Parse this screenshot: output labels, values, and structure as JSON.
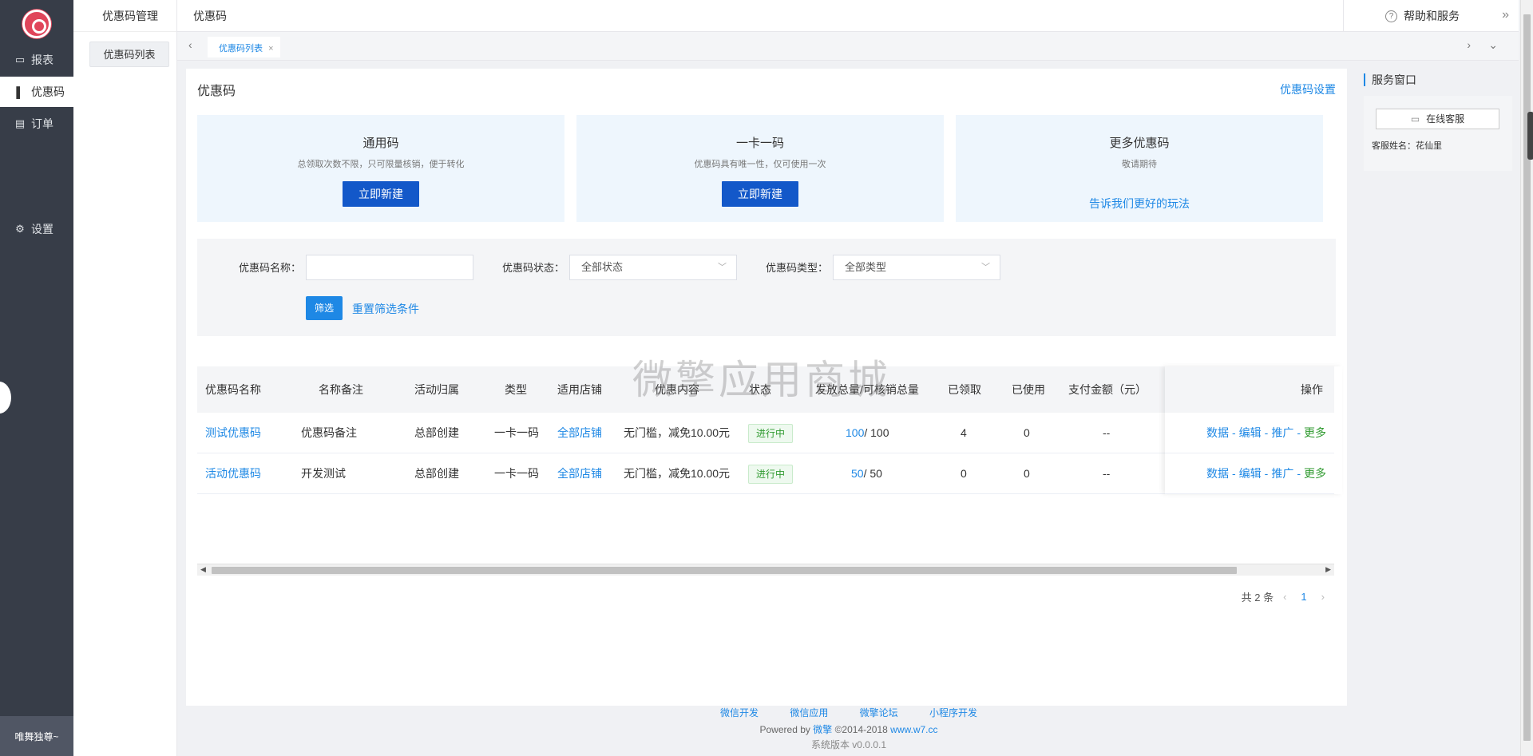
{
  "sidebar": {
    "items": [
      {
        "icon": "monitor-icon",
        "glyph": "▭",
        "label": "报表"
      },
      {
        "icon": "bar-chart-icon",
        "glyph": "▌",
        "label": "优惠码"
      },
      {
        "icon": "document-icon",
        "glyph": "▤",
        "label": "订单"
      },
      {
        "icon": "gear-icon",
        "glyph": "⚙",
        "label": "设置"
      }
    ],
    "user": "唯舞独尊~"
  },
  "subside": {
    "title": "优惠码管理",
    "item": "优惠码列表"
  },
  "header": {
    "crumb": "优惠码",
    "help": "帮助和服务"
  },
  "tabs": [
    {
      "label": "优惠码列表"
    }
  ],
  "page": {
    "title": "优惠码",
    "settings_link": "优惠码设置"
  },
  "cards": [
    {
      "title": "通用码",
      "desc": "总领取次数不限，只可限量核销，便于转化",
      "button": "立即新建"
    },
    {
      "title": "一卡一码",
      "desc": "优惠码具有唯一性，仅可使用一次",
      "button": "立即新建"
    },
    {
      "title": "更多优惠码",
      "desc": "敬请期待",
      "link": "告诉我们更好的玩法"
    }
  ],
  "filter": {
    "name_label": "优惠码名称：",
    "name_value": "",
    "status_label": "优惠码状态：",
    "status_value": "全部状态",
    "type_label": "优惠码类型：",
    "type_value": "全部类型",
    "submit": "筛选",
    "reset": "重置筛选条件"
  },
  "table": {
    "columns": [
      "优惠码名称",
      "名称备注",
      "活动归属",
      "类型",
      "适用店铺",
      "优惠内容",
      "状态",
      "发放总量/可核销总量",
      "已领取",
      "已使用",
      "支付金额（元）",
      "操作"
    ],
    "rows": [
      {
        "name": "测试优惠码",
        "note": "优惠码备注",
        "owner": "总部创建",
        "type": "一卡一码",
        "shop": "全部店铺",
        "content": "无门槛，减免10.00元",
        "status": "进行中",
        "issued": "100",
        "usable": "/ 100",
        "received": "4",
        "used": "0",
        "amount": "--"
      },
      {
        "name": "活动优惠码",
        "note": "开发测试",
        "owner": "总部创建",
        "type": "一卡一码",
        "shop": "全部店铺",
        "content": "无门槛，减免10.00元",
        "status": "进行中",
        "issued": "50",
        "usable": "/ 50",
        "received": "0",
        "used": "0",
        "amount": "--"
      }
    ],
    "actions": {
      "data": "数据",
      "edit": "编辑",
      "promote": "推广",
      "more": "更多",
      "sep": "-"
    }
  },
  "pager": {
    "total": "共 2 条",
    "current": "1"
  },
  "watermark": "微擎应用商城",
  "service": {
    "title": "服务窗口",
    "button": "在线客服",
    "name": "客服姓名：花仙里"
  },
  "footer": {
    "links": [
      "微信开发",
      "微信应用",
      "微擎论坛",
      "小程序开发"
    ],
    "powered_prefix": "Powered by",
    "powered_brand": "微擎",
    "copyright": "©2014-2018",
    "site": "www.w7.cc",
    "version": "系统版本 v0.0.0.1"
  },
  "colors": {
    "accent": "#1e88e5",
    "primary_button": "#1358c9",
    "sidebar_bg": "#373d48",
    "status_green": "#2f9a2f"
  }
}
